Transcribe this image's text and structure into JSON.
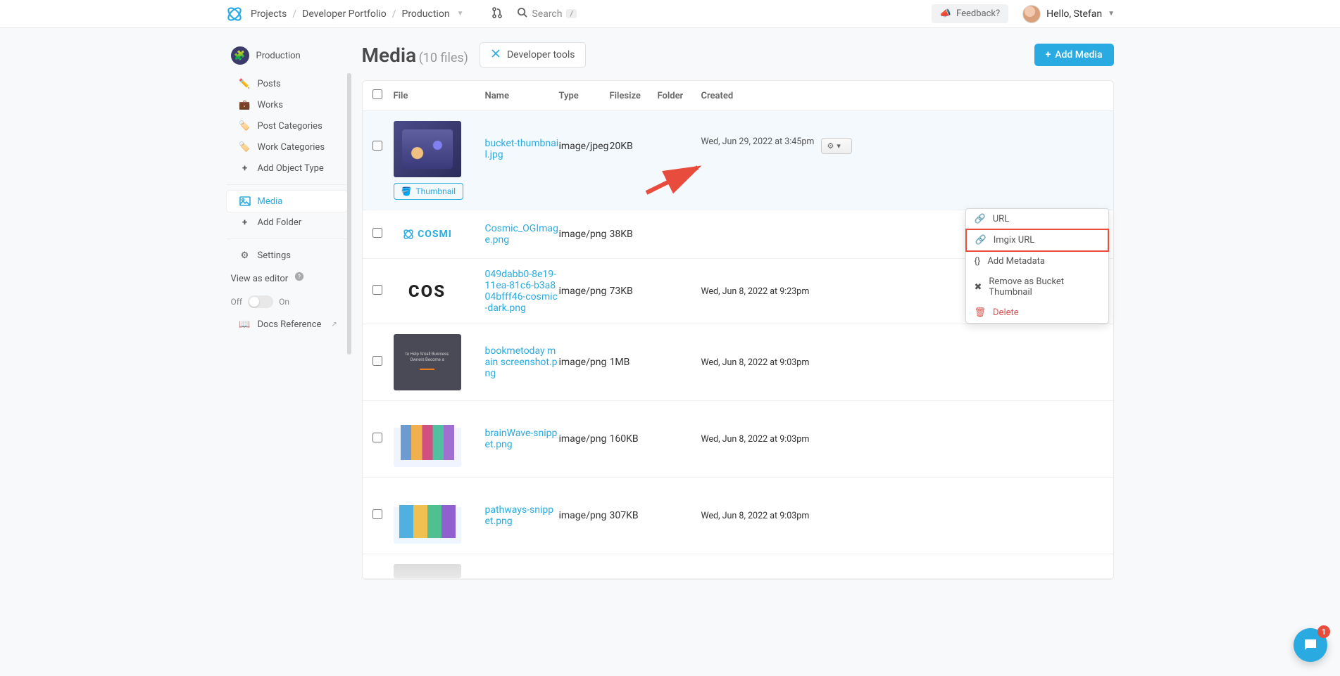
{
  "breadcrumb": {
    "root": "Projects",
    "project": "Developer Portfolio",
    "bucket": "Production"
  },
  "header": {
    "search_label": "Search",
    "search_kbd": "/",
    "feedback": "Feedback?",
    "greeting": "Hello, Stefan"
  },
  "sidebar": {
    "bucket_name": "Production",
    "items": {
      "posts": "Posts",
      "works": "Works",
      "post_categories": "Post Categories",
      "work_categories": "Work Categories",
      "add_object_type": "Add Object Type",
      "media": "Media",
      "add_folder": "Add Folder",
      "settings": "Settings",
      "view_as_editor": "View as editor",
      "toggle_off": "Off",
      "toggle_on": "On",
      "docs_reference": "Docs Reference"
    }
  },
  "main": {
    "title": "Media",
    "file_count": "(10 files)",
    "developer_tools": "Developer tools",
    "add_media": "Add Media"
  },
  "table": {
    "headers": {
      "file": "File",
      "name": "Name",
      "type": "Type",
      "filesize": "Filesize",
      "folder": "Folder",
      "created": "Created"
    },
    "thumbnail_badge": "Thumbnail",
    "rows": [
      {
        "name": "bucket-thumbnail.jpg",
        "type": "image/jpeg",
        "filesize": "20KB",
        "created": "Wed, Jun 29, 2022 at 3:45pm",
        "thumb": "purple",
        "badge": true
      },
      {
        "name": "Cosmic_OGImage.png",
        "type": "image/png",
        "filesize": "38KB",
        "created": "",
        "thumb": "cosmi"
      },
      {
        "name": "049dabb0-8e19-11ea-81c6-b3a804bfff46-cosmic-dark.png",
        "type": "image/png",
        "filesize": "73KB",
        "created": "Wed, Jun 8, 2022 at 9:23pm",
        "thumb": "cos"
      },
      {
        "name": "bookmetoday main screenshot.png",
        "type": "image/png",
        "filesize": "1MB",
        "created": "Wed, Jun 8, 2022 at 9:03pm",
        "thumb": "bookme"
      },
      {
        "name": "brainWave-snippet.png",
        "type": "image/png",
        "filesize": "160KB",
        "created": "Wed, Jun 8, 2022 at 9:03pm",
        "thumb": "brainwave"
      },
      {
        "name": "pathways-snippet.png",
        "type": "image/png",
        "filesize": "307KB",
        "created": "Wed, Jun 8, 2022 at 9:03pm",
        "thumb": "pathways"
      },
      {
        "name": "",
        "type": "",
        "filesize": "",
        "created": "",
        "thumb": "partial"
      }
    ]
  },
  "dropdown": {
    "url": "URL",
    "imgix_url": "Imgix URL",
    "add_metadata": "Add Metadata",
    "remove_thumbnail": "Remove as Bucket Thumbnail",
    "delete": "Delete"
  },
  "cosmi_text": "COSMI",
  "cos_text": "COS",
  "chat": {
    "badge": "1"
  }
}
